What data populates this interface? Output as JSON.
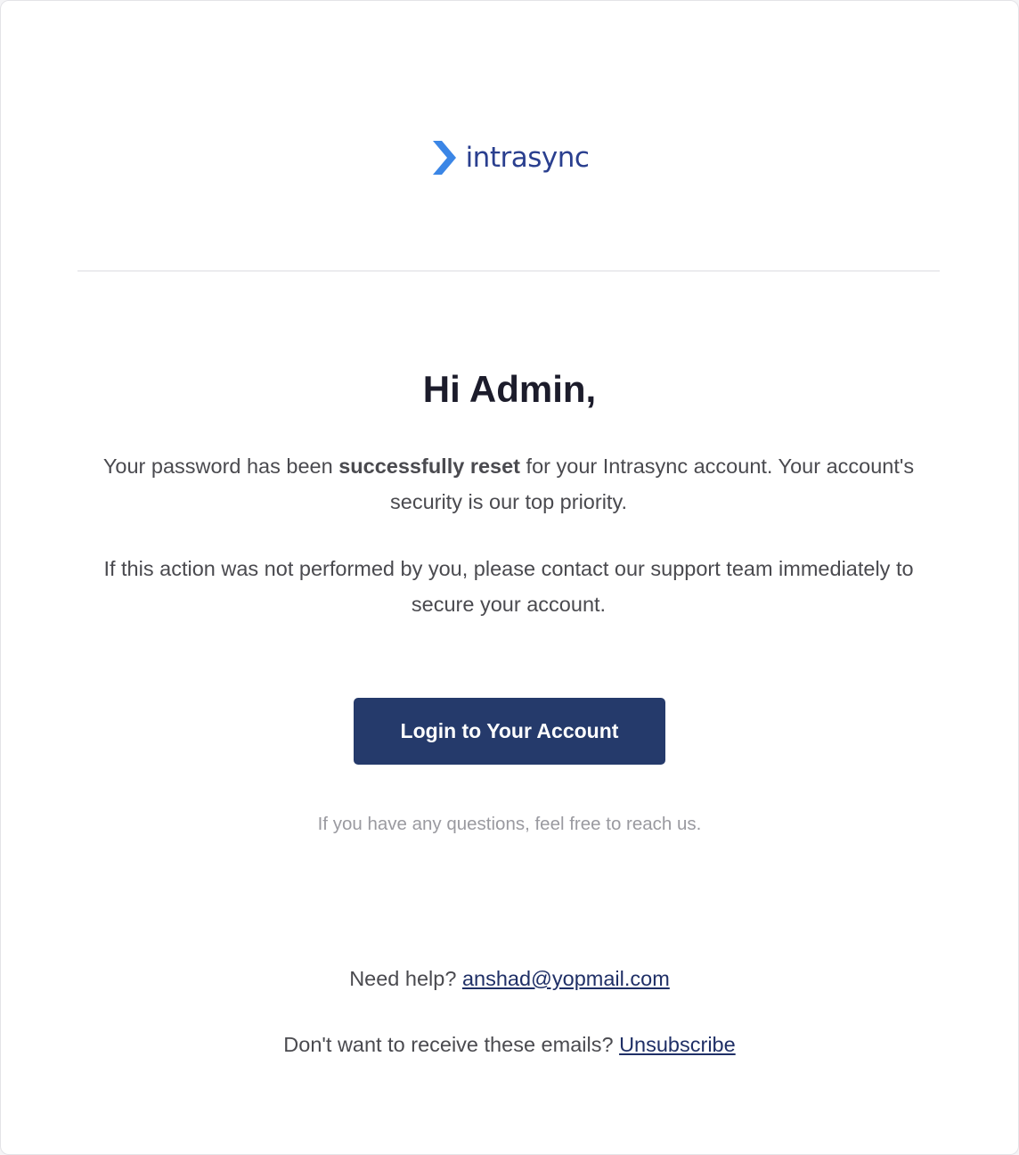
{
  "colors": {
    "brand_text": "#2a3f8f",
    "logo_chevron": "#3b86e6",
    "heading": "#1c1c2b",
    "body_text": "#4a4a4f",
    "muted_text": "#9a9aa0",
    "button_bg": "#253a6b",
    "link": "#1f2f66"
  },
  "logo": {
    "icon": "chevron-right-icon",
    "text": "intrasync"
  },
  "email": {
    "greeting": "Hi Admin,",
    "paragraph1": {
      "before": "Your password has been ",
      "bold": "successfully reset",
      "after": " for your Intrasync account. Your account's security is our top priority."
    },
    "paragraph2": "If this action was not performed by you, please contact our support team immediately to secure your account.",
    "button_label": "Login to Your Account",
    "note": "If you have any questions, feel free to reach us."
  },
  "footer": {
    "help_prefix": "Need help? ",
    "help_email": "anshad@yopmail.com",
    "unsubscribe_prefix": "Don't want to receive these emails? ",
    "unsubscribe_label": "Unsubscribe"
  }
}
